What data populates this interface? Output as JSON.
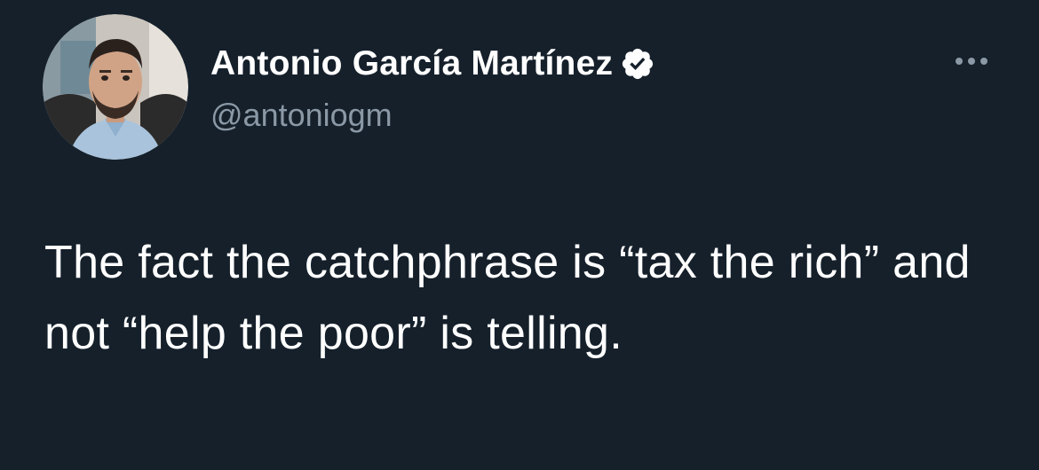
{
  "tweet": {
    "author": {
      "display_name": "Antonio García Martínez",
      "handle": "@antoniogm",
      "verified": true
    },
    "text": "The fact the catchphrase is “tax the rich” and not “help the poor” is telling."
  },
  "icons": {
    "verified": "verified-badge-icon",
    "more": "more-options-icon"
  },
  "colors": {
    "background": "#15202b",
    "primary_text": "#ffffff",
    "secondary_text": "#8b98a5"
  }
}
